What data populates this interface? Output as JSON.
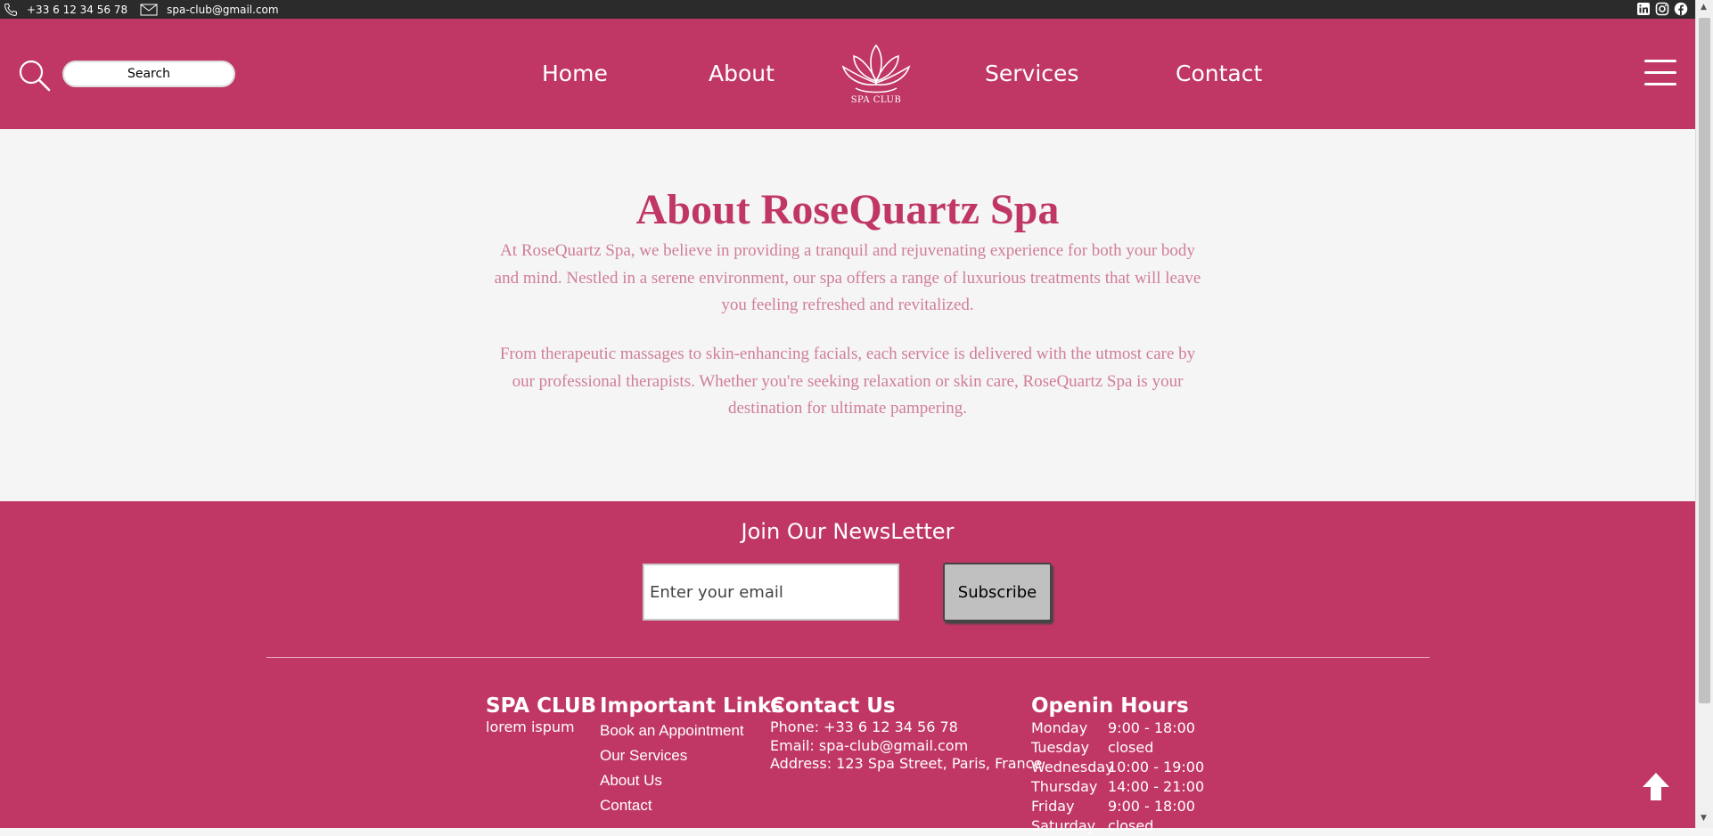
{
  "topbar": {
    "phone": "+33 6 12 34 56 78",
    "email": "spa-club@gmail.com",
    "social_icons": [
      "linkedin-icon",
      "instagram-icon",
      "facebook-icon"
    ]
  },
  "header": {
    "search_placeholder": "Search",
    "nav": {
      "home": "Home",
      "about": "About",
      "services": "Services",
      "contact": "Contact"
    },
    "logo_text": "SPA CLUB",
    "colors": {
      "brand": "#c03765",
      "topbar": "#2b2b2b"
    }
  },
  "about": {
    "title": "About RoseQuartz Spa",
    "paragraph1": "At RoseQuartz Spa, we believe in providing a tranquil and rejuvenating experience for both your body and mind. Nestled in a serene environment, our spa offers a range of luxurious treatments that will leave you feeling refreshed and revitalized.",
    "paragraph2": "From therapeutic massages to skin-enhancing facials, each service is delivered with the utmost care by our professional therapists. Whether you're seeking relaxation or skin care, RoseQuartz Spa is your destination for ultimate pampering."
  },
  "newsletter": {
    "title": "Join Our NewsLetter",
    "email_placeholder": "Enter your email",
    "subscribe_label": "Subscribe"
  },
  "footer": {
    "brand": {
      "title": "SPA CLUB",
      "subtitle": "lorem ispum"
    },
    "links": {
      "title": "Important Links",
      "items": [
        "Book an Appointment",
        "Our Services",
        "About Us",
        "Contact"
      ]
    },
    "contact": {
      "title": "Contact Us",
      "phone": "Phone: +33 6 12 34 56 78",
      "email": "Email: spa-club@gmail.com",
      "address": "Address: 123 Spa Street, Paris, France"
    },
    "hours": {
      "title": "Openin Hours",
      "rows": [
        {
          "day": "Monday",
          "time": "9:00 - 18:00"
        },
        {
          "day": "Tuesday",
          "time": "closed"
        },
        {
          "day": "Wednesday",
          "time": "10:00 - 19:00"
        },
        {
          "day": "Thursday",
          "time": "14:00 - 21:00"
        },
        {
          "day": "Friday",
          "time": "9:00 - 18:00"
        },
        {
          "day": "Saturday",
          "time": "closed"
        }
      ]
    }
  }
}
